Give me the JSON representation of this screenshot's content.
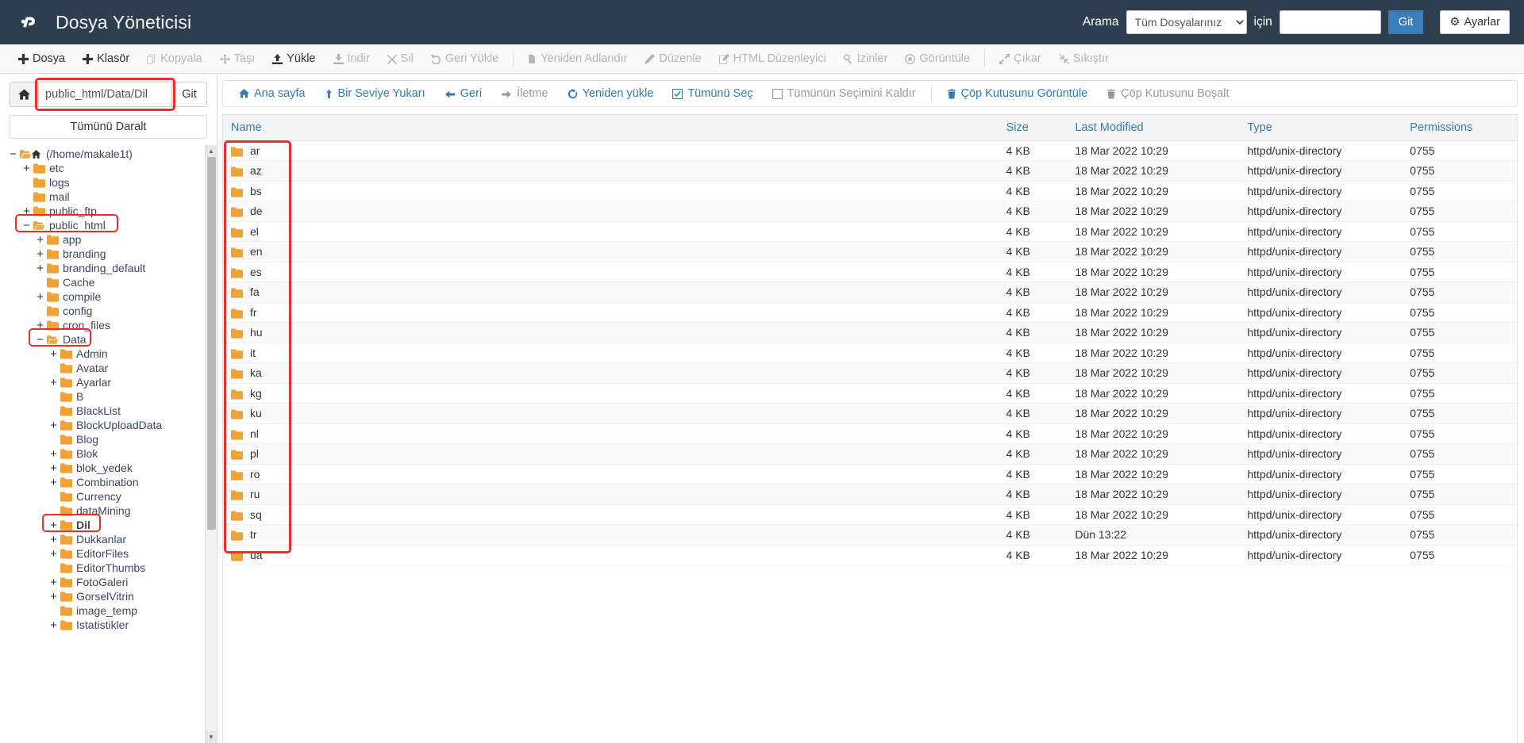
{
  "masthead": {
    "logo_icon": "cpanel-logo-icon",
    "title": "Dosya Yöneticisi",
    "search_label": "Arama",
    "search_scope_selected": "Tüm Dosyalarınız",
    "search_scope_options": [
      "Tüm Dosyalarınız"
    ],
    "for_label": "için",
    "search_value": "",
    "go_label": "Git",
    "settings_label": "Ayarlar",
    "settings_icon": "gear-icon",
    "bg_color": "#2e3e4e"
  },
  "toolbar": {
    "items": [
      {
        "label": "Dosya",
        "icon": "plus-icon",
        "enabled": true
      },
      {
        "label": "Klasör",
        "icon": "plus-icon",
        "enabled": true
      },
      {
        "label": "Kopyala",
        "icon": "copy-icon",
        "enabled": false
      },
      {
        "label": "Taşı",
        "icon": "move-icon",
        "enabled": false
      },
      {
        "label": "Yükle",
        "icon": "upload-icon",
        "enabled": true
      },
      {
        "label": "İndir",
        "icon": "download-icon",
        "enabled": false
      },
      {
        "label": "Sil",
        "icon": "close-x-icon",
        "enabled": false
      },
      {
        "label": "Geri Yükle",
        "icon": "undo-icon",
        "enabled": false
      },
      {
        "label": "Yeniden Adlandır",
        "icon": "file-icon",
        "enabled": false,
        "sep_before": true
      },
      {
        "label": "Düzenle",
        "icon": "pencil-icon",
        "enabled": false
      },
      {
        "label": "HTML Düzenleyici",
        "icon": "edit-square-icon",
        "enabled": false
      },
      {
        "label": "İzinler",
        "icon": "key-icon",
        "enabled": false
      },
      {
        "label": "Görüntüle",
        "icon": "eye-icon",
        "enabled": false
      },
      {
        "label": "Çıkar",
        "icon": "extract-icon",
        "enabled": false,
        "sep_before": true
      },
      {
        "label": "Sıkıştır",
        "icon": "compress-icon",
        "enabled": false
      }
    ]
  },
  "sidebar": {
    "home_icon": "home-icon",
    "path_value": "public_html/Data/Dil",
    "path_git_label": "Git",
    "collapse_all_label": "Tümünü Daralt",
    "tree": [
      {
        "label": "(/home/makale1t)",
        "indent": 0,
        "toggle": "−",
        "icon": "folder-open-home-icon",
        "highlight": false,
        "bold": false
      },
      {
        "label": "etc",
        "indent": 1,
        "toggle": "+",
        "icon": "folder-icon",
        "highlight": false,
        "bold": false
      },
      {
        "label": "logs",
        "indent": 1,
        "toggle": "",
        "icon": "folder-icon",
        "highlight": false,
        "bold": false
      },
      {
        "label": "mail",
        "indent": 1,
        "toggle": "",
        "icon": "folder-icon",
        "highlight": false,
        "bold": false
      },
      {
        "label": "public_ftp",
        "indent": 1,
        "toggle": "+",
        "icon": "folder-icon",
        "highlight": false,
        "bold": false
      },
      {
        "label": "public_html",
        "indent": 1,
        "toggle": "−",
        "icon": "folder-open-icon",
        "highlight": true,
        "bold": false
      },
      {
        "label": "app",
        "indent": 2,
        "toggle": "+",
        "icon": "folder-icon",
        "highlight": false,
        "bold": false
      },
      {
        "label": "branding",
        "indent": 2,
        "toggle": "+",
        "icon": "folder-icon",
        "highlight": false,
        "bold": false
      },
      {
        "label": "branding_default",
        "indent": 2,
        "toggle": "+",
        "icon": "folder-icon",
        "highlight": false,
        "bold": false
      },
      {
        "label": "Cache",
        "indent": 2,
        "toggle": "",
        "icon": "folder-icon",
        "highlight": false,
        "bold": false
      },
      {
        "label": "compile",
        "indent": 2,
        "toggle": "+",
        "icon": "folder-icon",
        "highlight": false,
        "bold": false
      },
      {
        "label": "config",
        "indent": 2,
        "toggle": "",
        "icon": "folder-icon",
        "highlight": false,
        "bold": false
      },
      {
        "label": "cron_files",
        "indent": 2,
        "toggle": "+",
        "icon": "folder-icon",
        "highlight": false,
        "bold": false
      },
      {
        "label": "Data",
        "indent": 2,
        "toggle": "−",
        "icon": "folder-open-icon",
        "highlight": true,
        "bold": false
      },
      {
        "label": "Admin",
        "indent": 3,
        "toggle": "+",
        "icon": "folder-icon",
        "highlight": false,
        "bold": false
      },
      {
        "label": "Avatar",
        "indent": 3,
        "toggle": "",
        "icon": "folder-icon",
        "highlight": false,
        "bold": false
      },
      {
        "label": "Ayarlar",
        "indent": 3,
        "toggle": "+",
        "icon": "folder-icon",
        "highlight": false,
        "bold": false
      },
      {
        "label": "B",
        "indent": 3,
        "toggle": "",
        "icon": "folder-icon",
        "highlight": false,
        "bold": false
      },
      {
        "label": "BlackList",
        "indent": 3,
        "toggle": "",
        "icon": "folder-icon",
        "highlight": false,
        "bold": false
      },
      {
        "label": "BlockUploadData",
        "indent": 3,
        "toggle": "+",
        "icon": "folder-icon",
        "highlight": false,
        "bold": false
      },
      {
        "label": "Blog",
        "indent": 3,
        "toggle": "",
        "icon": "folder-icon",
        "highlight": false,
        "bold": false
      },
      {
        "label": "Blok",
        "indent": 3,
        "toggle": "+",
        "icon": "folder-icon",
        "highlight": false,
        "bold": false
      },
      {
        "label": "blok_yedek",
        "indent": 3,
        "toggle": "+",
        "icon": "folder-icon",
        "highlight": false,
        "bold": false
      },
      {
        "label": "Combination",
        "indent": 3,
        "toggle": "+",
        "icon": "folder-icon",
        "highlight": false,
        "bold": false
      },
      {
        "label": "Currency",
        "indent": 3,
        "toggle": "",
        "icon": "folder-icon",
        "highlight": false,
        "bold": false
      },
      {
        "label": "dataMining",
        "indent": 3,
        "toggle": "",
        "icon": "folder-icon",
        "highlight": false,
        "bold": false
      },
      {
        "label": "Dil",
        "indent": 3,
        "toggle": "+",
        "icon": "folder-icon",
        "highlight": true,
        "bold": true
      },
      {
        "label": "Dukkanlar",
        "indent": 3,
        "toggle": "+",
        "icon": "folder-icon",
        "highlight": false,
        "bold": false
      },
      {
        "label": "EditorFiles",
        "indent": 3,
        "toggle": "+",
        "icon": "folder-icon",
        "highlight": false,
        "bold": false
      },
      {
        "label": "EditorThumbs",
        "indent": 3,
        "toggle": "",
        "icon": "folder-icon",
        "highlight": false,
        "bold": false
      },
      {
        "label": "FotoGaleri",
        "indent": 3,
        "toggle": "+",
        "icon": "folder-icon",
        "highlight": false,
        "bold": false
      },
      {
        "label": "GorselVitrin",
        "indent": 3,
        "toggle": "+",
        "icon": "folder-icon",
        "highlight": false,
        "bold": false
      },
      {
        "label": "image_temp",
        "indent": 3,
        "toggle": "",
        "icon": "folder-icon",
        "highlight": false,
        "bold": false
      },
      {
        "label": "Istatistikler",
        "indent": 3,
        "toggle": "+",
        "icon": "folder-icon",
        "highlight": false,
        "bold": false
      }
    ]
  },
  "navbar": {
    "items": [
      {
        "label": "Ana sayfa",
        "icon": "home-icon",
        "muted": false
      },
      {
        "label": "Bir Seviye Yukarı",
        "icon": "arrow-up-icon",
        "muted": false
      },
      {
        "label": "Geri",
        "icon": "arrow-left-icon",
        "muted": false
      },
      {
        "label": "İletme",
        "icon": "arrow-right-icon",
        "muted": true
      },
      {
        "label": "Yeniden yükle",
        "icon": "reload-icon",
        "muted": false
      },
      {
        "label": "Tümünü Seç",
        "icon": "checkbox-checked-icon",
        "muted": false
      },
      {
        "label": "Tümünün Seçimini Kaldır",
        "icon": "checkbox-empty-icon",
        "muted": true
      },
      {
        "label": "Çöp Kutusunu Görüntüle",
        "icon": "trash-icon",
        "muted": false,
        "sep_before": true
      },
      {
        "label": "Çöp Kutusunu Boşalt",
        "icon": "trash-icon",
        "muted": true
      }
    ]
  },
  "table": {
    "columns": [
      "Name",
      "Size",
      "Last Modified",
      "Type",
      "Permissions"
    ],
    "rows": [
      {
        "name": "ar",
        "size": "4 KB",
        "modified": "18 Mar 2022 10:29",
        "type": "httpd/unix-directory",
        "permissions": "0755"
      },
      {
        "name": "az",
        "size": "4 KB",
        "modified": "18 Mar 2022 10:29",
        "type": "httpd/unix-directory",
        "permissions": "0755"
      },
      {
        "name": "bs",
        "size": "4 KB",
        "modified": "18 Mar 2022 10:29",
        "type": "httpd/unix-directory",
        "permissions": "0755"
      },
      {
        "name": "de",
        "size": "4 KB",
        "modified": "18 Mar 2022 10:29",
        "type": "httpd/unix-directory",
        "permissions": "0755"
      },
      {
        "name": "el",
        "size": "4 KB",
        "modified": "18 Mar 2022 10:29",
        "type": "httpd/unix-directory",
        "permissions": "0755"
      },
      {
        "name": "en",
        "size": "4 KB",
        "modified": "18 Mar 2022 10:29",
        "type": "httpd/unix-directory",
        "permissions": "0755"
      },
      {
        "name": "es",
        "size": "4 KB",
        "modified": "18 Mar 2022 10:29",
        "type": "httpd/unix-directory",
        "permissions": "0755"
      },
      {
        "name": "fa",
        "size": "4 KB",
        "modified": "18 Mar 2022 10:29",
        "type": "httpd/unix-directory",
        "permissions": "0755"
      },
      {
        "name": "fr",
        "size": "4 KB",
        "modified": "18 Mar 2022 10:29",
        "type": "httpd/unix-directory",
        "permissions": "0755"
      },
      {
        "name": "hu",
        "size": "4 KB",
        "modified": "18 Mar 2022 10:29",
        "type": "httpd/unix-directory",
        "permissions": "0755"
      },
      {
        "name": "it",
        "size": "4 KB",
        "modified": "18 Mar 2022 10:29",
        "type": "httpd/unix-directory",
        "permissions": "0755"
      },
      {
        "name": "ka",
        "size": "4 KB",
        "modified": "18 Mar 2022 10:29",
        "type": "httpd/unix-directory",
        "permissions": "0755"
      },
      {
        "name": "kg",
        "size": "4 KB",
        "modified": "18 Mar 2022 10:29",
        "type": "httpd/unix-directory",
        "permissions": "0755"
      },
      {
        "name": "ku",
        "size": "4 KB",
        "modified": "18 Mar 2022 10:29",
        "type": "httpd/unix-directory",
        "permissions": "0755"
      },
      {
        "name": "nl",
        "size": "4 KB",
        "modified": "18 Mar 2022 10:29",
        "type": "httpd/unix-directory",
        "permissions": "0755"
      },
      {
        "name": "pl",
        "size": "4 KB",
        "modified": "18 Mar 2022 10:29",
        "type": "httpd/unix-directory",
        "permissions": "0755"
      },
      {
        "name": "ro",
        "size": "4 KB",
        "modified": "18 Mar 2022 10:29",
        "type": "httpd/unix-directory",
        "permissions": "0755"
      },
      {
        "name": "ru",
        "size": "4 KB",
        "modified": "18 Mar 2022 10:29",
        "type": "httpd/unix-directory",
        "permissions": "0755"
      },
      {
        "name": "sq",
        "size": "4 KB",
        "modified": "18 Mar 2022 10:29",
        "type": "httpd/unix-directory",
        "permissions": "0755"
      },
      {
        "name": "tr",
        "size": "4 KB",
        "modified": "Dün 13:22",
        "type": "httpd/unix-directory",
        "permissions": "0755"
      },
      {
        "name": "ua",
        "size": "4 KB",
        "modified": "18 Mar 2022 10:29",
        "type": "httpd/unix-directory",
        "permissions": "0755"
      }
    ]
  },
  "annotations": {
    "highlight_color": "#e8302a"
  }
}
